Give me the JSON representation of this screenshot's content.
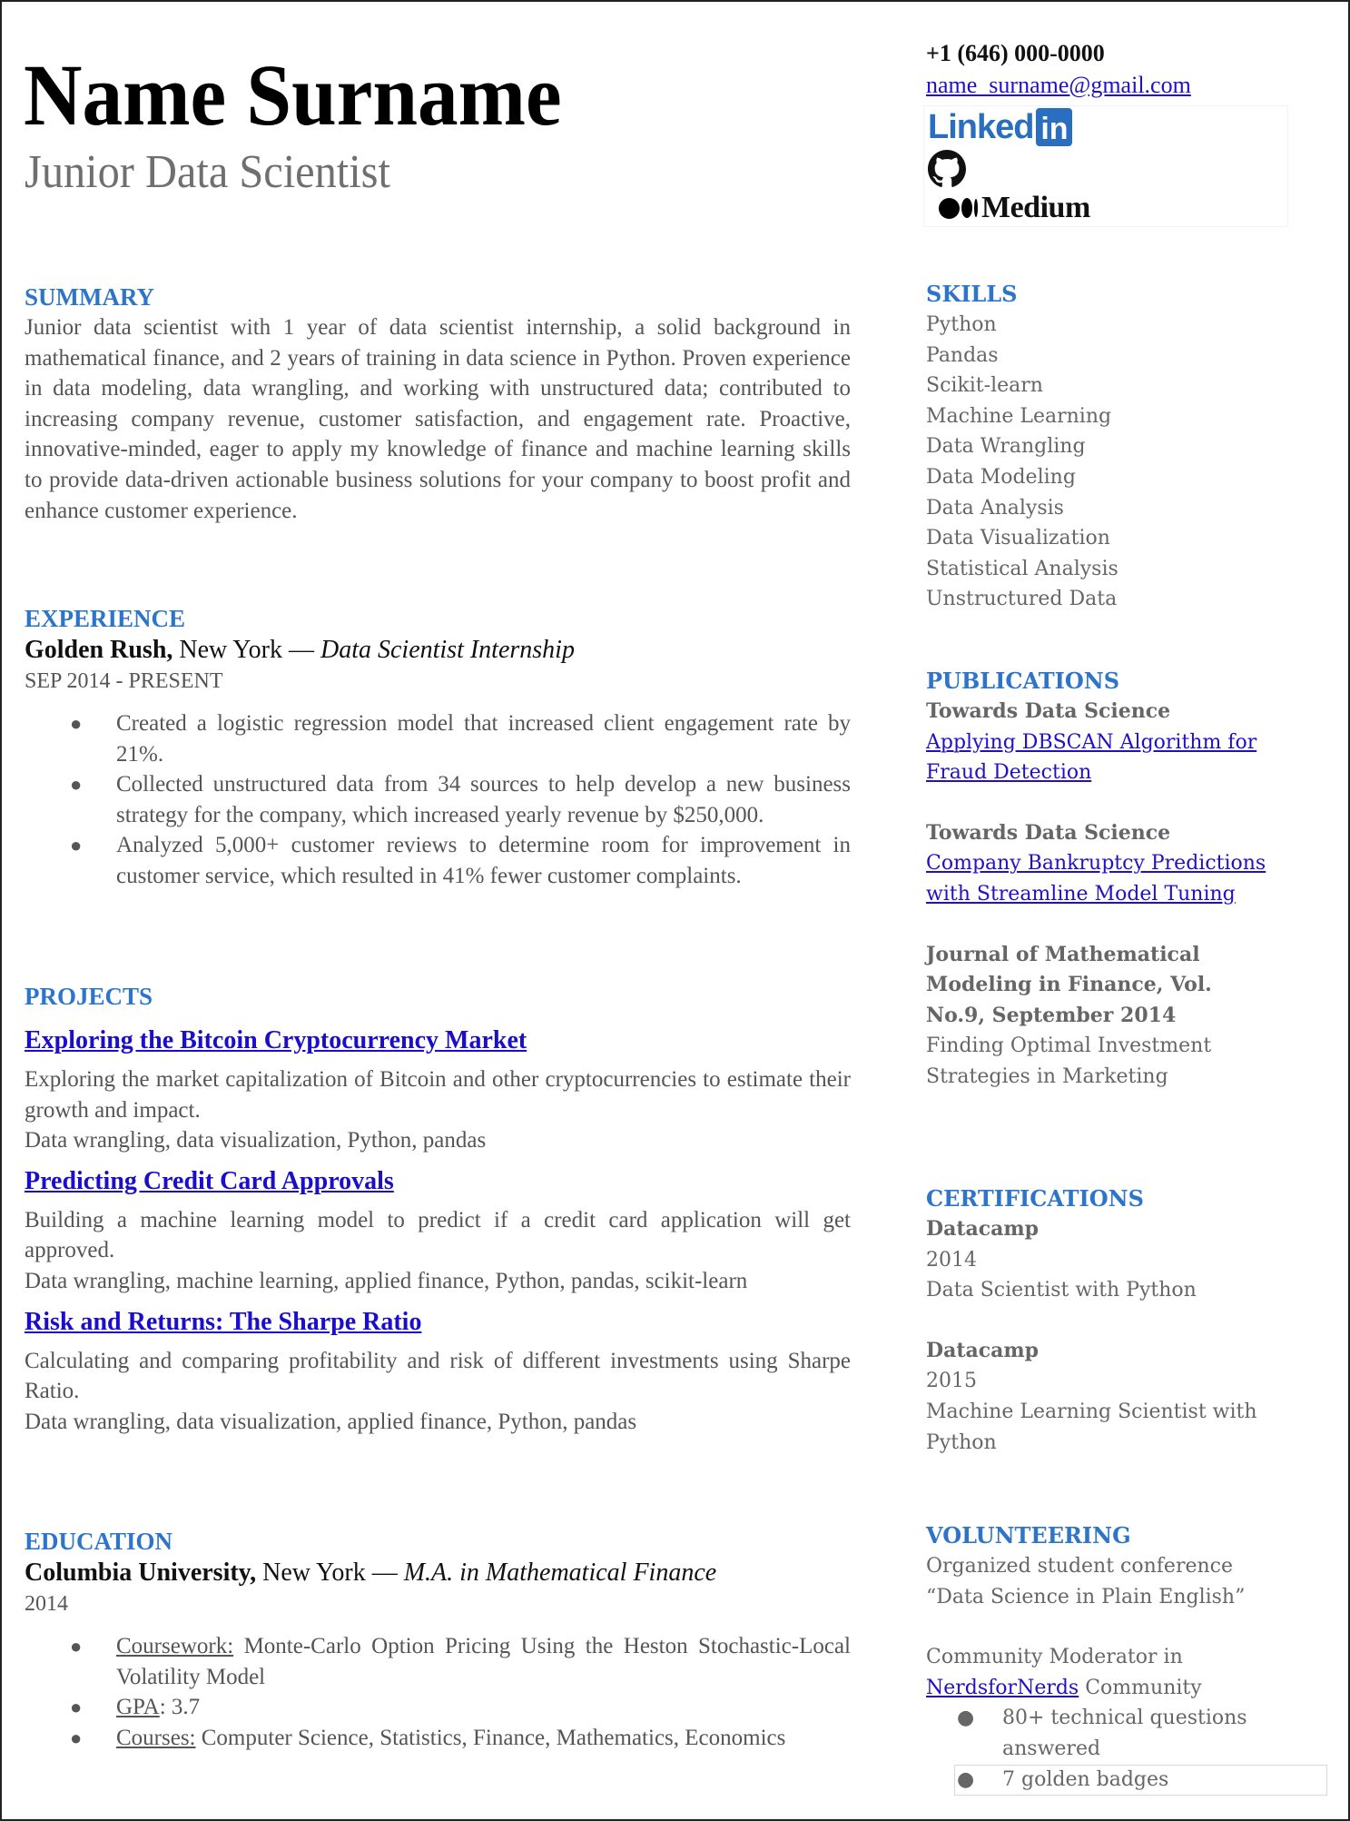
{
  "header": {
    "name": "Name Surname",
    "title": "Junior Data Scientist",
    "phone": "+1 (646) 000-0000",
    "email": "name_surname@gmail.com",
    "social": {
      "linkedin_word": "Linked",
      "linkedin_in": "in",
      "github_icon": "github-icon",
      "medium_word": "Medium"
    }
  },
  "summary": {
    "heading": "SUMMARY",
    "text": "Junior data scientist with 1 year of data scientist internship, a solid background in mathematical finance, and 2 years of training in data science in Python. Proven experience in data modeling, data wrangling, and working with unstructured data; contributed to increasing company revenue, customer satisfaction, and engagement rate. Proactive, innovative-minded, eager to apply my knowledge of finance and machine learning skills to provide data-driven actionable business solutions for your company to boost profit and enhance customer experience."
  },
  "experience": {
    "heading": "EXPERIENCE",
    "jobs": [
      {
        "company": "Golden Rush,",
        "location": " New York — ",
        "role": "Data Scientist Internship",
        "dates": "SEP 2014 - PRESENT",
        "bullets": [
          "Created a logistic regression model that increased client engagement rate by 21%.",
          "Collected unstructured data from 34 sources to help develop a new business strategy for the company, which increased yearly revenue by $250,000.",
          "Analyzed 5,000+ customer reviews to determine room for improvement in customer service, which resulted in 41% fewer customer complaints."
        ]
      }
    ]
  },
  "projects": {
    "heading": "PROJECTS",
    "items": [
      {
        "title": "Exploring the Bitcoin Cryptocurrency Market",
        "description": "Exploring the market capitalization of Bitcoin and other cryptocurrencies to estimate their growth and impact.",
        "tools": "Data wrangling, data visualization, Python, pandas"
      },
      {
        "title": "Predicting Credit Card Approvals",
        "description": "Building a machine learning model to predict if a credit card application will get approved.",
        "tools": "Data wrangling, machine learning, applied finance, Python, pandas, scikit-learn"
      },
      {
        "title": "Risk and Returns: The Sharpe Ratio",
        "description": "Calculating and comparing profitability and risk of different investments using Sharpe Ratio.",
        "tools": "Data wrangling, data visualization, applied finance, Python, pandas"
      }
    ]
  },
  "education": {
    "heading": "EDUCATION",
    "school": "Columbia University,",
    "location": " New York — ",
    "degree": "M.A. in Mathematical Finance",
    "year": "2014",
    "bullets": [
      {
        "label": "Coursework:",
        "text": " Monte-Carlo Option Pricing Using the Heston Stochastic-Local Volatility Model"
      },
      {
        "label": "GPA",
        "text": ": 3.7"
      },
      {
        "label": "Courses:",
        "text": " Computer Science, Statistics, Finance, Mathematics, Economics"
      }
    ]
  },
  "skills": {
    "heading": "SKILLS",
    "items": [
      "Python",
      "Pandas",
      "Scikit-learn",
      "Machine Learning",
      "Data Wrangling",
      "Data Modeling",
      "Data Analysis",
      "Data Visualization",
      "Statistical Analysis",
      "Unstructured Data"
    ]
  },
  "publications": {
    "heading": "PUBLICATIONS",
    "items": [
      {
        "source": "Towards Data Science",
        "title": "Applying DBSCAN Algorithm for Fraud Detection",
        "link": true
      },
      {
        "source": "Towards Data Science",
        "title": "Company Bankruptcy Predictions with Streamline Model Tuning",
        "link": true
      },
      {
        "source": "Journal of Mathematical Modeling in Finance, Vol. No.9, September 2014",
        "title": "Finding Optimal Investment Strategies in Marketing",
        "link": false
      }
    ]
  },
  "certifications": {
    "heading": "CERTIFICATIONS",
    "items": [
      {
        "issuer": "Datacamp",
        "year": "2014",
        "name": "Data Scientist with Python"
      },
      {
        "issuer": "Datacamp",
        "year": "2015",
        "name": "Machine Learning Scientist with Python"
      }
    ]
  },
  "volunteering": {
    "heading": "VOLUNTEERING",
    "item1": "Organized student conference “Data Science in Plain English”",
    "item2_prefix": "Community Moderator in ",
    "item2_link": "NerdsforNerds",
    "item2_suffix": " Community",
    "bullets": [
      "80+ technical questions answered",
      "7 golden badges"
    ]
  },
  "colors": {
    "heading_blue": "#2e75c9",
    "link_blue": "#1a0dcc",
    "body_gray": "#555555",
    "linkedin_blue": "#2a6ebf"
  }
}
